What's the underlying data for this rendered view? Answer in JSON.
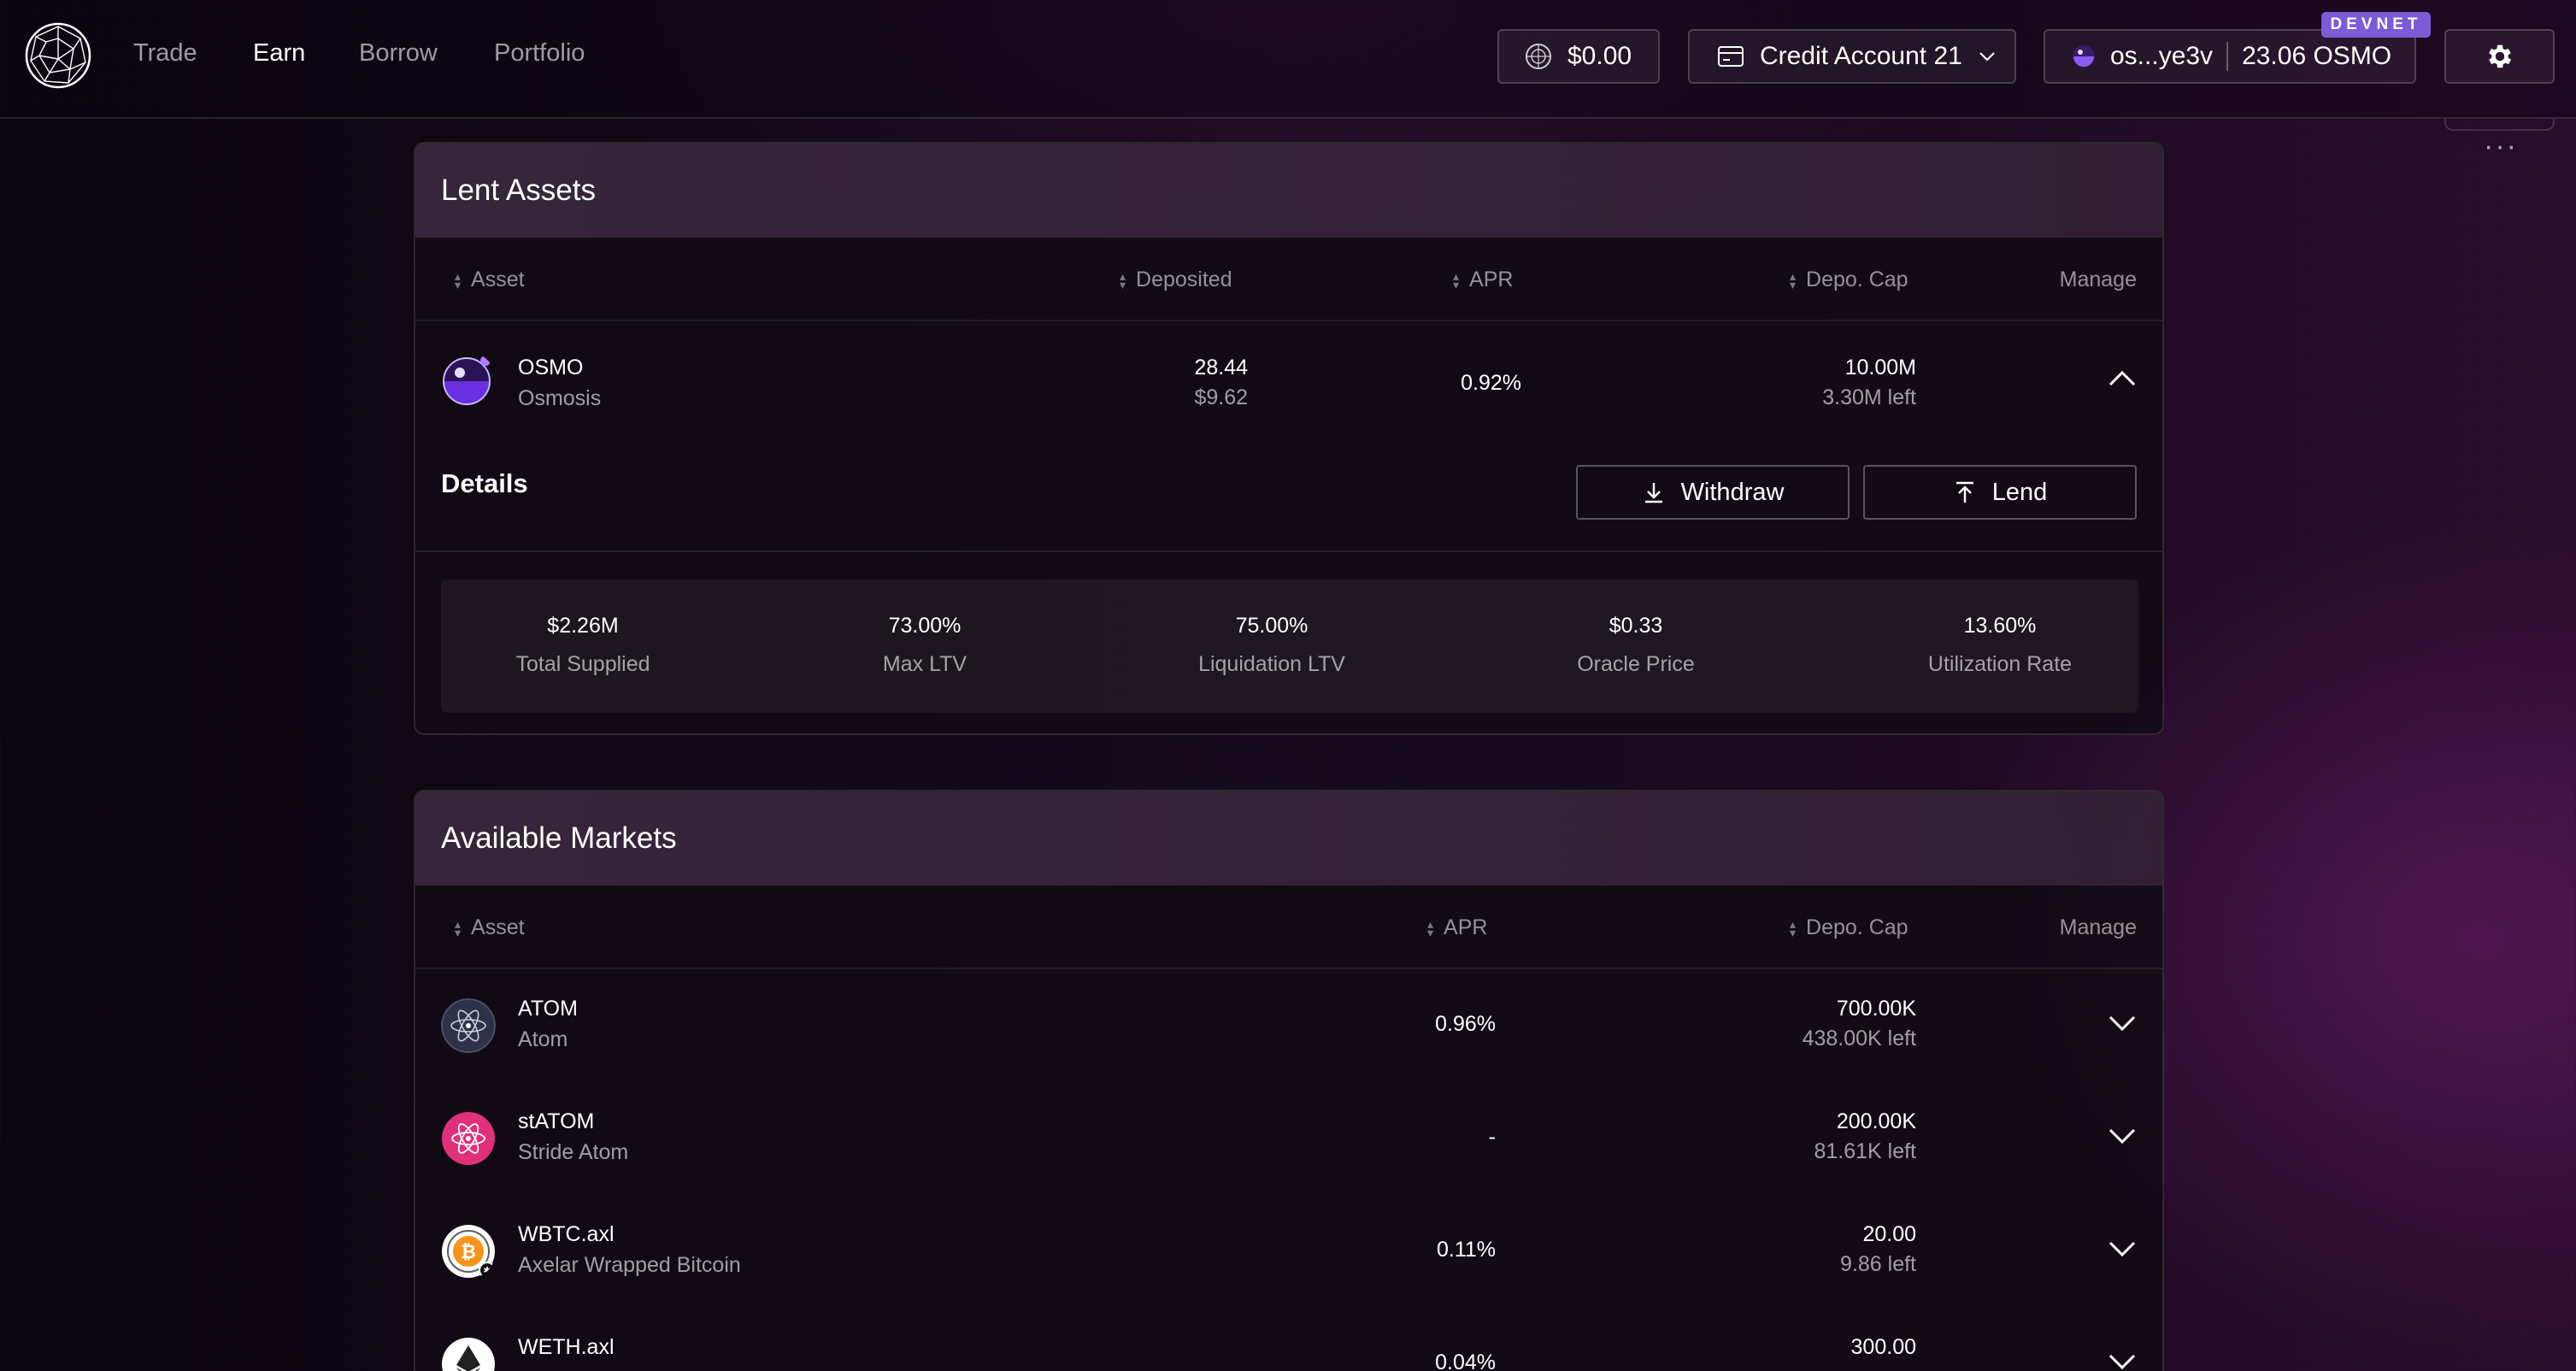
{
  "nav": {
    "items": [
      {
        "label": "Trade"
      },
      {
        "label": "Earn"
      },
      {
        "label": "Borrow"
      },
      {
        "label": "Portfolio"
      }
    ]
  },
  "header": {
    "balance": "$0.00",
    "account": "Credit Account 21",
    "wallet_address": "os...ye3v",
    "wallet_balance": "23.06 OSMO",
    "network_badge": "DEVNET",
    "more": "···"
  },
  "lent": {
    "title": "Lent Assets",
    "columns": {
      "asset": "Asset",
      "deposited": "Deposited",
      "apr": "APR",
      "cap": "Depo. Cap",
      "manage": "Manage"
    },
    "row": {
      "symbol": "OSMO",
      "name": "Osmosis",
      "deposited": "28.44",
      "deposited_usd": "$9.62",
      "apr": "0.92%",
      "cap": "10.00M",
      "cap_left": "3.30M left"
    },
    "details": {
      "title": "Details",
      "withdraw": "Withdraw",
      "lend": "Lend",
      "stats": [
        {
          "value": "$2.26M",
          "label": "Total Supplied"
        },
        {
          "value": "73.00%",
          "label": "Max LTV"
        },
        {
          "value": "75.00%",
          "label": "Liquidation LTV"
        },
        {
          "value": "$0.33",
          "label": "Oracle Price"
        },
        {
          "value": "13.60%",
          "label": "Utilization Rate"
        }
      ]
    }
  },
  "markets": {
    "title": "Available Markets",
    "columns": {
      "asset": "Asset",
      "apr": "APR",
      "cap": "Depo. Cap",
      "manage": "Manage"
    },
    "rows": [
      {
        "symbol": "ATOM",
        "name": "Atom",
        "apr": "0.96%",
        "cap": "700.00K",
        "cap_left": "438.00K left"
      },
      {
        "symbol": "stATOM",
        "name": "Stride Atom",
        "apr": "-",
        "cap": "200.00K",
        "cap_left": "81.61K left"
      },
      {
        "symbol": "WBTC.axl",
        "name": "Axelar Wrapped Bitcoin",
        "apr": "0.11%",
        "cap": "20.00",
        "cap_left": "9.86 left"
      },
      {
        "symbol": "WETH.axl",
        "name": "",
        "apr": "0.04%",
        "cap": "300.00",
        "cap_left": ""
      }
    ]
  },
  "colors": {
    "accent": "#7b5bd6",
    "osmo": "#5e2bd1",
    "statom": "#e0307a",
    "btc": "#f7931a"
  }
}
